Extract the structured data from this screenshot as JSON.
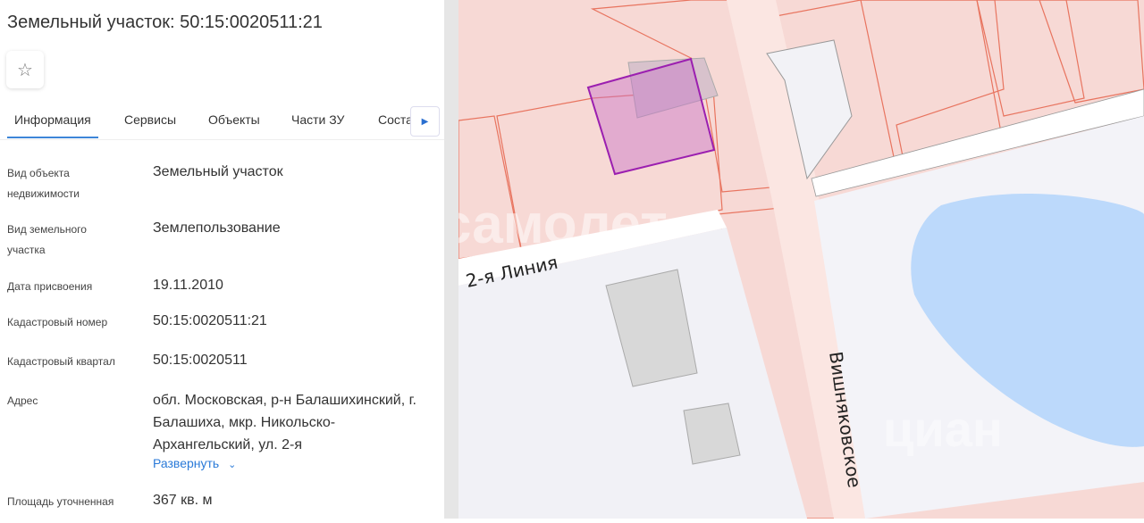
{
  "title": "Земельный участок: 50:15:0020511:21",
  "favorite_icon": "star-icon",
  "tabs": [
    "Информация",
    "Сервисы",
    "Объекты",
    "Части ЗУ",
    "Соста"
  ],
  "fields": [
    {
      "label": "Вид объекта недвижимости",
      "value": "Земельный участок"
    },
    {
      "label": "Вид земельного участка",
      "value": "Землепользование"
    },
    {
      "label": "Дата присвоения",
      "value": "19.11.2010"
    },
    {
      "label": "Кадастровый номер",
      "value": "50:15:0020511:21"
    },
    {
      "label": "Кадастровый квартал",
      "value": "50:15:0020511"
    },
    {
      "label": "Адрес",
      "value": "обл. Московская, р-н Балашихинский, г. Балашиха, мкр. Никольско-Архангельский, ул. 2-я"
    },
    {
      "label": "Площадь уточненная",
      "value": "367 кв. м"
    }
  ],
  "expand_label": "Развернуть",
  "map": {
    "street1": "2-я Линия",
    "street2": "Вишняковское",
    "watermark1": "самолет",
    "watermark2": "циан"
  }
}
